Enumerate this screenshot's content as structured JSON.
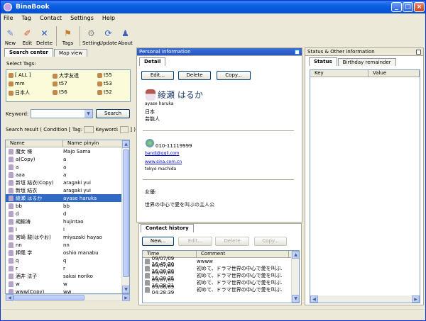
{
  "window": {
    "title": "BinaBook"
  },
  "menu": [
    "File",
    "Tag",
    "Contact",
    "Settings",
    "Help"
  ],
  "toolbar": {
    "new": "New",
    "edit": "Edit",
    "delete": "Delete",
    "tags": "Tags",
    "setting": "Setting",
    "update": "Update",
    "about": "About"
  },
  "left": {
    "tab_search": "Search center",
    "tab_map": "Map view",
    "select_tags": "Select Tags:",
    "tags": [
      "[ ALL ]",
      "大学友達",
      "t55",
      "mm",
      "t57",
      "t53",
      "日本人",
      "t56",
      "t52"
    ],
    "keyword_label": "Keyword:",
    "keyword_value": "",
    "search_btn": "Search",
    "result_label": "Search result ( Condition [ Tag:",
    "result_keyword": "Keyword:",
    "result_end": "] )",
    "col_name": "Name",
    "col_pinyin": "Name pinyin",
    "rows": [
      {
        "n": "魔女 様",
        "p": "Majo Sama"
      },
      {
        "n": "a(Copy)",
        "p": "a"
      },
      {
        "n": "a",
        "p": "a"
      },
      {
        "n": "aaa",
        "p": "a"
      },
      {
        "n": "新垣 結衣(Copy)",
        "p": "aragaki yui"
      },
      {
        "n": "新垣 結衣",
        "p": "aragaki yui"
      },
      {
        "n": "綾瀬 はるか",
        "p": "ayase haruka"
      },
      {
        "n": "bb",
        "p": "bb"
      },
      {
        "n": "d",
        "p": "d"
      },
      {
        "n": "胡錦涛",
        "p": "hujintao"
      },
      {
        "n": "i",
        "p": "i"
      },
      {
        "n": "宮崎 駿(はやお)",
        "p": "miyazaki hayao"
      },
      {
        "n": "nn",
        "p": "nn"
      },
      {
        "n": "押尾 学",
        "p": "oshio manabu"
      },
      {
        "n": "q",
        "p": "q"
      },
      {
        "n": "r",
        "p": "r"
      },
      {
        "n": "酒井 法子",
        "p": "sakai noriko"
      },
      {
        "n": "w",
        "p": "w"
      },
      {
        "n": "www(Copy)",
        "p": "ww"
      }
    ]
  },
  "middle": {
    "title": "Personal Information",
    "tab_detail": "Detail",
    "edit": "Edit...",
    "delete": "Delete",
    "copy": "Copy...",
    "name": "綾瀬 はるか",
    "pinyin": "ayase haruka",
    "country": "日本",
    "job": "芸能人",
    "phone": "010-11119999",
    "email": "bandj@gqli.com",
    "web": "www.sina.com.cn",
    "address": "tokyo machida",
    "hobby_label": "女優:",
    "note": "世界の中心で愛を叫ぶの主人公"
  },
  "history": {
    "title": "Contact history",
    "new": "New...",
    "edit": "Edit...",
    "delete": "Delete",
    "copy": "Copy...",
    "col_time": "Time",
    "col_comment": "Comment",
    "rows": [
      {
        "t": "09/07/09 16:45:20",
        "c": "wwww"
      },
      {
        "t": "09/07/09 16:38:28",
        "c": "初めて、ドラマ世界の中心で愛を叫ぶ..."
      },
      {
        "t": "09/07/09 16:38:25",
        "c": "初めて、ドラマ世界の中心で愛を叫ぶ..."
      },
      {
        "t": "09/07/09 16:38:21",
        "c": "初めて、ドラマ世界の中心で愛を叫ぶ..."
      },
      {
        "t": "09/06/09 04:28:39",
        "c": "初めて、ドラマ世界の中心で愛を叫ぶ..."
      }
    ]
  },
  "right": {
    "title": "Status & Other information",
    "tab_status": "Status",
    "tab_birthday": "Birthday remainder",
    "col_key": "Key",
    "col_value": "Value"
  }
}
